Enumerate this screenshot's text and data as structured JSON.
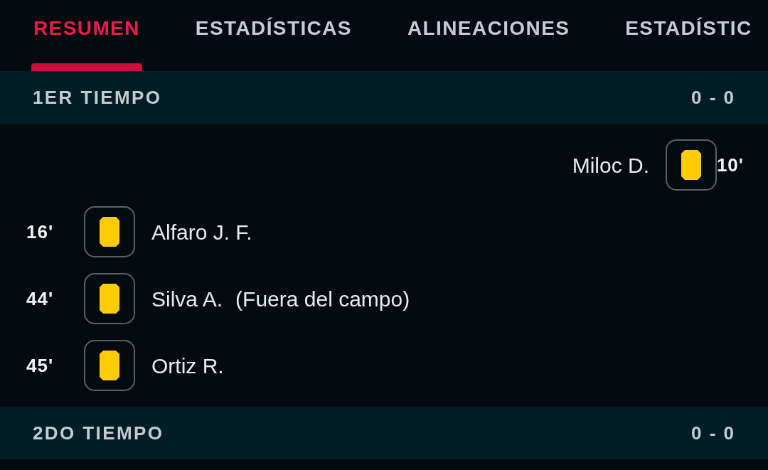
{
  "tabs": [
    {
      "label": "RESUMEN",
      "selected": true
    },
    {
      "label": "ESTADÍSTICAS",
      "selected": false
    },
    {
      "label": "ALINEACIONES",
      "selected": false
    },
    {
      "label": "ESTADÍSTIC",
      "selected": false
    }
  ],
  "periods": [
    {
      "title": "1ER TIEMPO",
      "score": "0 - 0",
      "events": [
        {
          "away": true,
          "kind": "yellow_card",
          "minute": "10'",
          "player": "Miloc D."
        },
        {
          "away": false,
          "kind": "yellow_card",
          "minute": "16'",
          "player": "Alfaro J. F."
        },
        {
          "away": false,
          "kind": "yellow_card",
          "minute": "44'",
          "player": "Silva A.",
          "note": "(Fuera del campo)"
        },
        {
          "away": false,
          "kind": "yellow_card",
          "minute": "45'",
          "player": "Ortiz R."
        }
      ]
    },
    {
      "title": "2DO TIEMPO",
      "score": "0 - 0"
    }
  ]
}
